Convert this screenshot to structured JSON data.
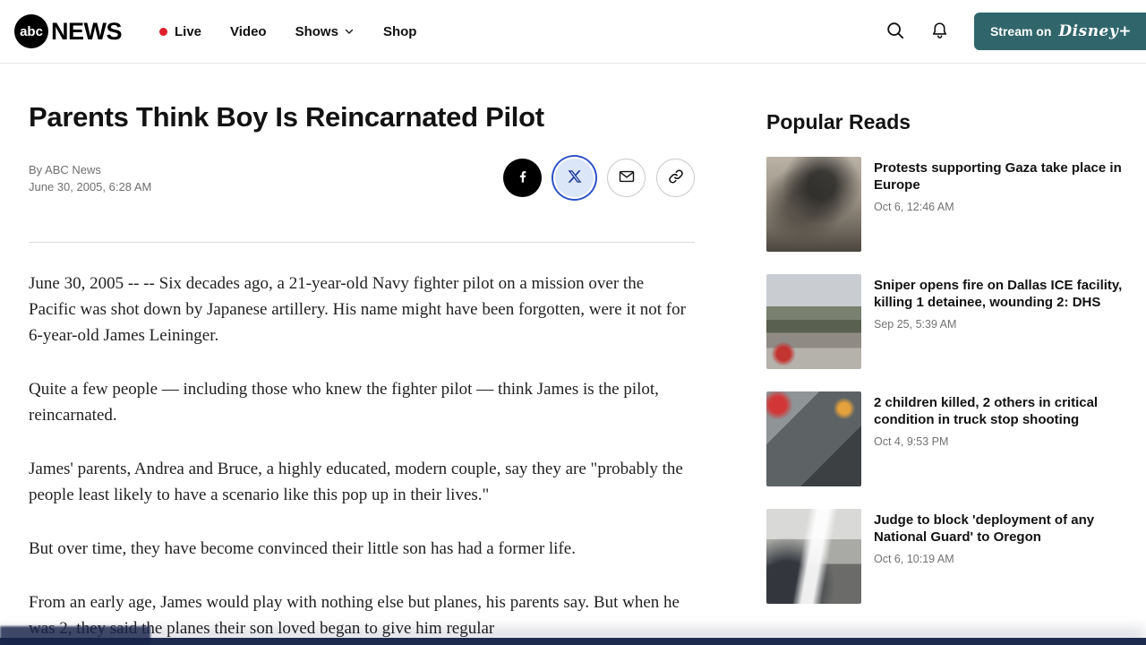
{
  "header": {
    "logo": {
      "abc": "abc",
      "news": "NEWS"
    },
    "nav": [
      {
        "label": "Live"
      },
      {
        "label": "Video"
      },
      {
        "label": "Shows"
      },
      {
        "label": "Shop"
      }
    ],
    "stream_button": {
      "prefix": "Stream on",
      "brand": "Disney+"
    }
  },
  "article": {
    "title": "Parents Think Boy Is Reincarnated Pilot",
    "byline": "By ABC News",
    "date": "June 30, 2005, 6:28 AM",
    "share_buttons": [
      {
        "name": "facebook"
      },
      {
        "name": "x",
        "state": "selected"
      },
      {
        "name": "email"
      },
      {
        "name": "copy-link"
      }
    ],
    "paragraphs": [
      "June 30, 2005 -- -- Six decades ago, a 21-year-old Navy fighter pilot on a mission over the Pacific was shot down by Japanese artillery. His name might have been forgotten, were it not for 6-year-old James Leininger.",
      "Quite a few people — including those who knew the fighter pilot — think James is the pilot, reincarnated.",
      "James' parents, Andrea and Bruce, a highly educated, modern couple, say they are \"probably the people least likely to have a scenario like this pop up in their lives.\"",
      "But over time, they have become convinced their little son has had a former life.",
      "From an early age, James would play with nothing else but planes, his parents say. But when he was 2, they said the planes their son loved began to give him regular"
    ]
  },
  "sidebar": {
    "title": "Popular Reads",
    "items": [
      {
        "headline": "Protests supporting Gaza take place in Europe",
        "time": "Oct 6, 12:46 AM"
      },
      {
        "headline": "Sniper opens fire on Dallas ICE facility, killing 1 detainee, wounding 2: DHS",
        "time": "Sep 25, 5:39 AM"
      },
      {
        "headline": "2 children killed, 2 others in critical condition in truck stop shooting",
        "time": "Oct 4, 9:53 PM"
      },
      {
        "headline": "Judge to block 'deployment of any National Guard' to Oregon",
        "time": "Oct 6, 10:19 AM"
      }
    ]
  },
  "colors": {
    "stream_button_bg": "#30666b",
    "live_dot": "#e01f2d",
    "x_selected_bg": "#dbe6f8",
    "x_selected_ring": "#2d52c8",
    "footer_bar": "#1d2b4e"
  }
}
